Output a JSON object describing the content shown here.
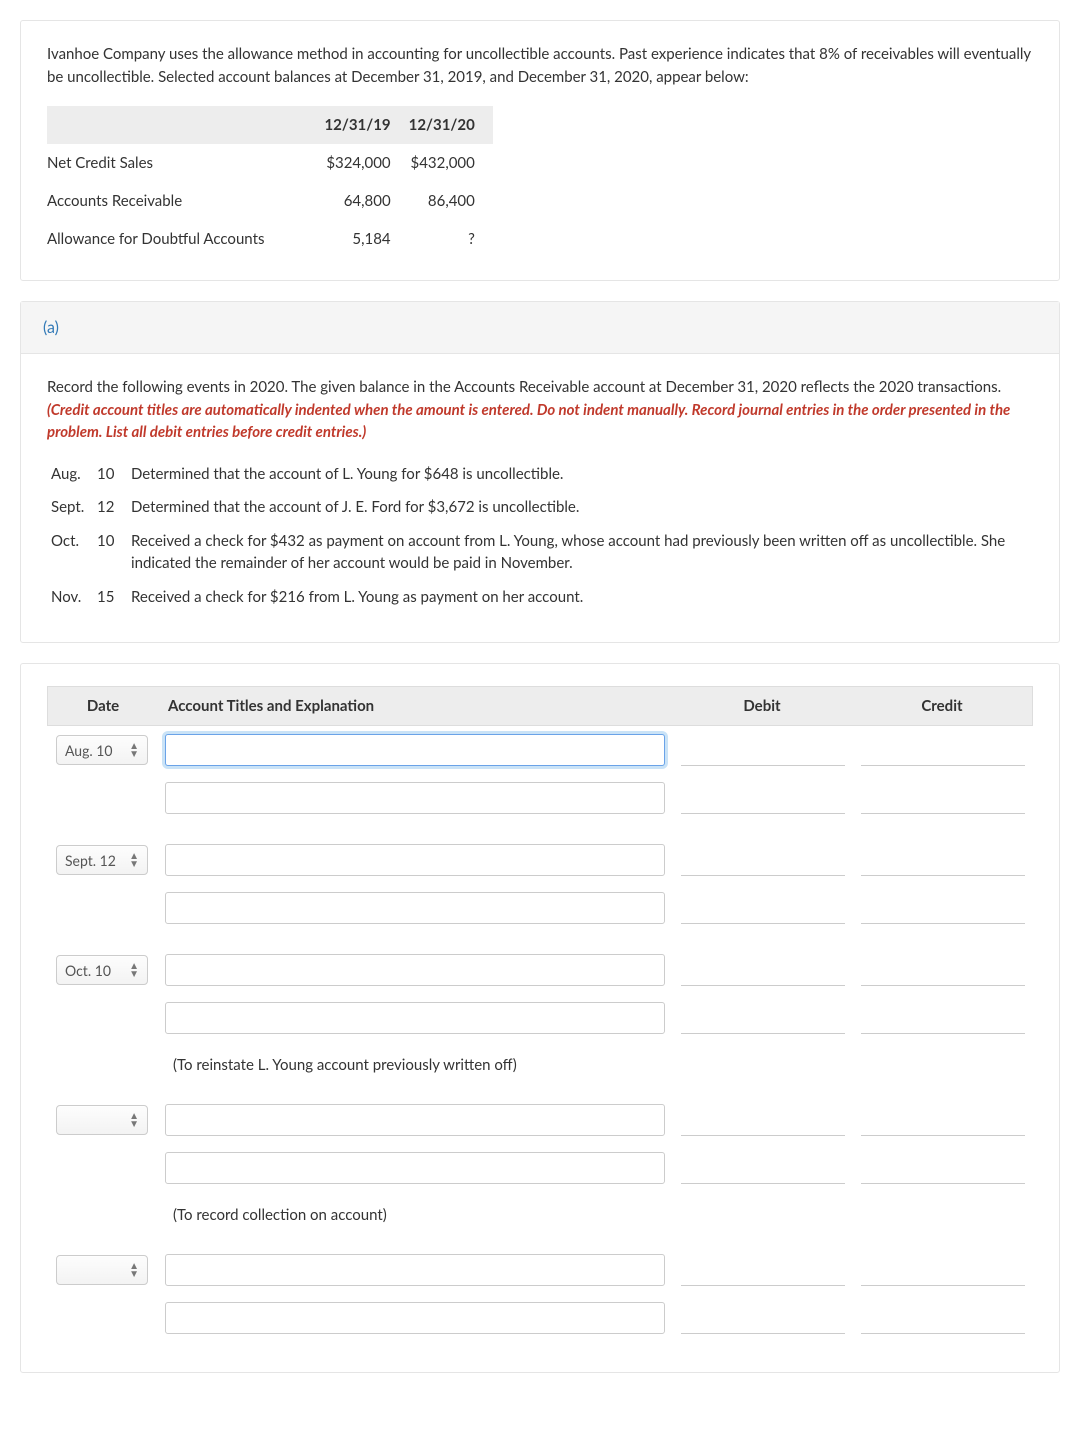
{
  "intro": "Ivanhoe Company uses the allowance method in accounting for uncollectible accounts. Past experience indicates that 8% of receivables will eventually be uncollectible. Selected account balances at December 31, 2019, and December 31, 2020, appear below:",
  "balances": {
    "headers": [
      "",
      "12/31/19",
      "12/31/20"
    ],
    "rows": [
      {
        "label": "Net Credit Sales",
        "c1": "$324,000",
        "c2": "$432,000"
      },
      {
        "label": "Accounts Receivable",
        "c1": "64,800",
        "c2": "86,400"
      },
      {
        "label": "Allowance for Doubtful Accounts",
        "c1": "5,184",
        "c2": "?"
      }
    ]
  },
  "part": {
    "label": "(a)",
    "instruction_plain": "Record the following events in 2020. The given balance in the Accounts Receivable account at December 31, 2020 reflects the 2020 transactions. ",
    "instruction_red": "(Credit account titles are automatically indented when the amount is entered. Do not indent manually. Record journal entries in the order presented in the problem. List all debit entries before credit entries.)"
  },
  "events": [
    {
      "month": "Aug.",
      "day": "10",
      "desc": "Determined that the account of L. Young for $648 is uncollectible."
    },
    {
      "month": "Sept.",
      "day": "12",
      "desc": "Determined that the account of J. E. Ford for $3,672 is uncollectible."
    },
    {
      "month": "Oct.",
      "day": "10",
      "desc": "Received a check for $432 as payment on account from L. Young, whose account had previously been written off as uncollectible. She indicated the remainder of her account would be paid in November."
    },
    {
      "month": "Nov.",
      "day": "15",
      "desc": "Received a check for $216 from L. Young as payment on her account."
    }
  ],
  "journal": {
    "headers": {
      "date": "Date",
      "title": "Account Titles and Explanation",
      "debit": "Debit",
      "credit": "Credit"
    },
    "dates": {
      "r0": "Aug. 10",
      "r1": "Sept. 12",
      "r2": "Oct. 10",
      "r3": "",
      "r4": ""
    },
    "explain": {
      "e1": "(To reinstate L. Young account previously written off)",
      "e2": "(To record collection on account)"
    }
  }
}
